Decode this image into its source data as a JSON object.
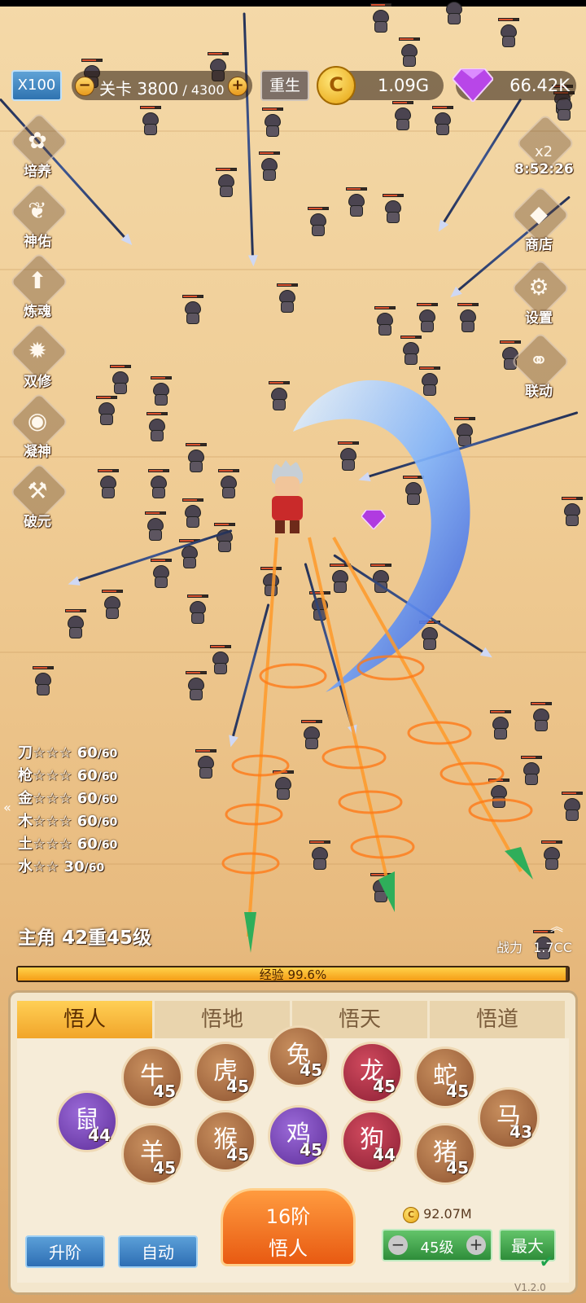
{
  "top_bar": {
    "speed_label": "X100",
    "stage_label": "关卡",
    "stage_current": "3800",
    "stage_sep": " / ",
    "stage_total": "4300",
    "minus": "−",
    "plus": "+",
    "rebirth_label": "重生",
    "gold": "1.09G",
    "gems": "66.42K"
  },
  "left_menu": [
    {
      "label": "培养",
      "icon": "cultivate-icon",
      "glyph": "✿"
    },
    {
      "label": "神佑",
      "icon": "blessing-wings-icon",
      "glyph": "❦"
    },
    {
      "label": "炼魂",
      "icon": "refine-arrow-icon",
      "glyph": "⬆"
    },
    {
      "label": "双修",
      "icon": "dual-flame-icon",
      "glyph": "✹"
    },
    {
      "label": "凝神",
      "icon": "focus-circle-icon",
      "glyph": "◉"
    },
    {
      "label": "破元",
      "icon": "hammer-icon",
      "glyph": "⚒"
    }
  ],
  "right_menu": {
    "boost": {
      "label": "x2",
      "timer": "8:52:26",
      "icon": "bag-icon"
    },
    "items": [
      {
        "label": "商店",
        "icon": "diamond-shop-icon",
        "glyph": "◆"
      },
      {
        "label": "设置",
        "icon": "gear-icon",
        "glyph": "⚙"
      },
      {
        "label": "联动",
        "icon": "link-icon",
        "glyph": "⚭"
      }
    ]
  },
  "weapons": [
    {
      "name": "刀",
      "stars": "☆☆☆",
      "level": "60",
      "max": "/60"
    },
    {
      "name": "枪",
      "stars": "☆☆☆",
      "level": "60",
      "max": "/60"
    },
    {
      "name": "金",
      "stars": "☆☆☆",
      "level": "60",
      "max": "/60"
    },
    {
      "name": "木",
      "stars": "☆☆☆",
      "level": "60",
      "max": "/60"
    },
    {
      "name": "土",
      "stars": "☆☆☆",
      "level": "60",
      "max": "/60"
    },
    {
      "name": "水",
      "stars": "☆☆",
      "level": "30",
      "max": "/60"
    }
  ],
  "hero": {
    "title": "主角 42重45级",
    "power_label": "战力",
    "power_value": "1.7CC",
    "exp_label": "经验 99.6%",
    "exp_percent": 99.6
  },
  "panel": {
    "tabs": [
      "悟人",
      "悟地",
      "悟天",
      "悟道"
    ],
    "active_tab": 0,
    "zodiac": [
      {
        "animal": "rat",
        "level": "44",
        "color": "purple",
        "glyph": "鼠"
      },
      {
        "animal": "ox",
        "level": "45",
        "color": "brown",
        "glyph": "牛"
      },
      {
        "animal": "goat",
        "level": "45",
        "color": "brown",
        "glyph": "羊"
      },
      {
        "animal": "tiger",
        "level": "45",
        "color": "brown",
        "glyph": "虎"
      },
      {
        "animal": "monkey",
        "level": "45",
        "color": "brown",
        "glyph": "猴"
      },
      {
        "animal": "rabbit",
        "level": "45",
        "color": "brown",
        "glyph": "兔"
      },
      {
        "animal": "rooster",
        "level": "45",
        "color": "purple",
        "glyph": "鸡"
      },
      {
        "animal": "dragon",
        "level": "45",
        "color": "red",
        "glyph": "龙"
      },
      {
        "animal": "dog",
        "level": "44",
        "color": "red",
        "glyph": "狗"
      },
      {
        "animal": "snake",
        "level": "45",
        "color": "brown",
        "glyph": "蛇"
      },
      {
        "animal": "pig",
        "level": "45",
        "color": "brown",
        "glyph": "猪"
      },
      {
        "animal": "horse",
        "level": "43",
        "color": "brown",
        "glyph": "马"
      }
    ],
    "upgrade_label": "升阶",
    "auto_label": "自动",
    "main_button_line1": "16阶",
    "main_button_line2": "悟人",
    "cost": "92.07M",
    "level_value": "45级",
    "max_label": "最大",
    "version": "V1.2.0"
  }
}
